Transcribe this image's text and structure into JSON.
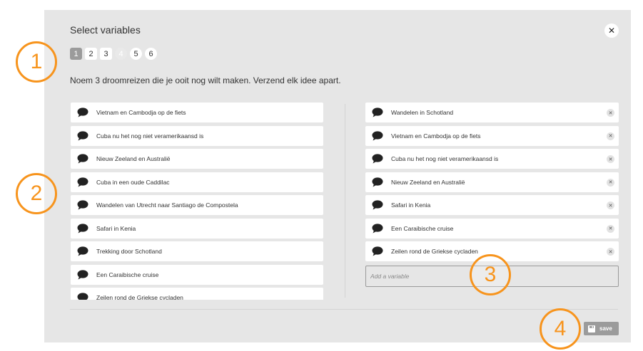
{
  "dialog": {
    "title": "Select variables",
    "close_glyph": "✕"
  },
  "pagination": [
    {
      "label": "1",
      "state": "active"
    },
    {
      "label": "2",
      "state": "normal"
    },
    {
      "label": "3",
      "state": "normal"
    },
    {
      "label": "4",
      "state": "disabled"
    },
    {
      "label": "5",
      "state": "round"
    },
    {
      "label": "6",
      "state": "round"
    }
  ],
  "instruction": "Noem 3 droomreizen die je ooit nog wilt maken. Verzend elk idee apart.",
  "available_items": [
    "Vietnam en Cambodja op de fiets",
    "Cuba nu het nog niet veramerikaansd is",
    "Nieuw Zeeland en Australië",
    "Cuba in een oude Caddilac",
    "Wandelen van Utrecht naar Santiago de Compostela",
    "Safari in Kenia",
    "Trekking door Schotland",
    "Een Caraibische cruise",
    "Zeilen rond de Griekse cycladen"
  ],
  "selected_items": [
    "Wandelen in Schotland",
    "Vietnam en Cambodja op de fiets",
    "Cuba nu het nog niet veramerikaansd is",
    "Nieuw Zeeland en Australië",
    "Safari in Kenia",
    "Een Caraibische cruise",
    "Zeilen rond de Griekse cycladen"
  ],
  "add_variable": {
    "placeholder": "Add a variable",
    "value": ""
  },
  "save": {
    "label": "save",
    "icon": "floppy-disk-icon"
  },
  "remove_glyph": "✕",
  "callouts": [
    "1",
    "2",
    "3",
    "4"
  ],
  "colors": {
    "accent_orange": "#f7941d",
    "modal_bg": "#e6e6e6",
    "button_gray": "#9b9b9b"
  }
}
